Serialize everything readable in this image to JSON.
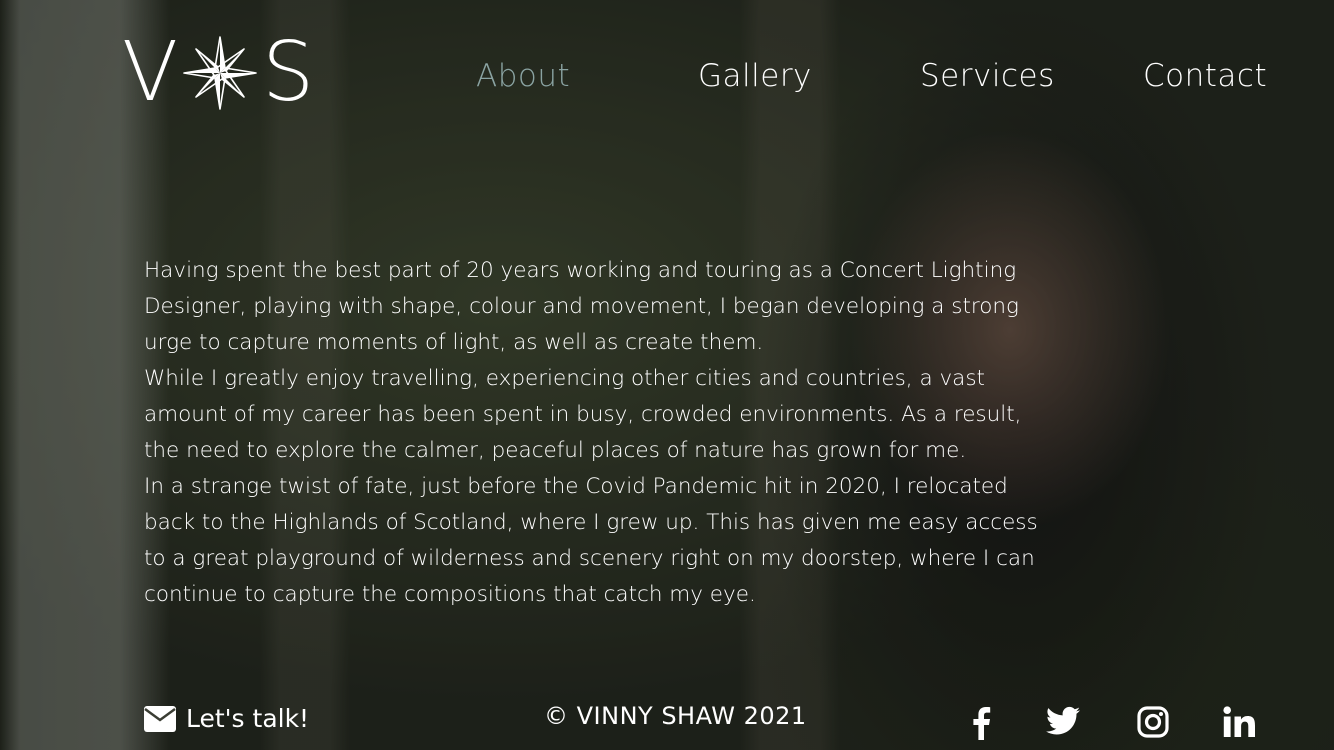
{
  "brand": {
    "letter_left": "V",
    "letter_right": "S"
  },
  "nav": {
    "items": [
      {
        "label": "About",
        "active": true
      },
      {
        "label": "Gallery",
        "active": false
      },
      {
        "label": "Services",
        "active": false
      },
      {
        "label": "Contact",
        "active": false
      }
    ],
    "active_color": "#8aa3a2"
  },
  "about": {
    "paragraphs": [
      "Having spent the best part of 20 years working and touring as a Concert Lighting Designer, playing with shape, colour and movement, I began developing a strong urge to capture moments of light, as well as create them.",
      "While I greatly enjoy travelling, experiencing other cities and countries, a vast amount of my career has been spent in busy, crowded environments. As a result, the need to explore the calmer, peaceful places of nature has grown for me.",
      "In a strange twist of fate, just before the Covid Pandemic hit in 2020, I relocated back to the Highlands of Scotland, where I grew up. This has given me easy access to a great playground of wilderness and scenery right on my doorstep, where I can continue to capture the compositions that catch my eye."
    ]
  },
  "footer": {
    "contact_label": "Let's talk!",
    "copyright": "© VINNY SHAW 2021",
    "social_icons": [
      "facebook-icon",
      "twitter-icon",
      "instagram-icon",
      "linkedin-icon"
    ]
  }
}
